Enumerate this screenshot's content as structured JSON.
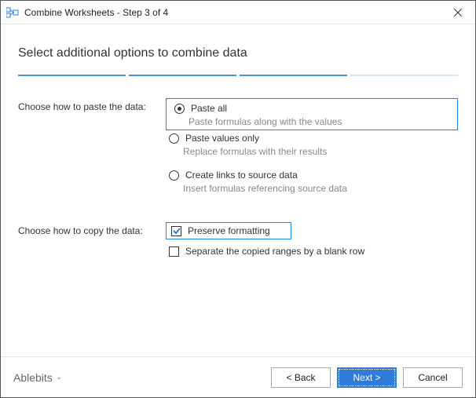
{
  "window": {
    "title": "Combine Worksheets - Step 3 of 4"
  },
  "heading": "Select additional options to combine data",
  "progress": {
    "current": 3,
    "total": 4
  },
  "paste_section": {
    "label": "Choose how to paste the data:",
    "options": [
      {
        "label": "Paste all",
        "desc": "Paste formulas along with the values",
        "selected": true
      },
      {
        "label": "Paste values only",
        "desc": "Replace formulas with their results",
        "selected": false
      },
      {
        "label": "Create links to source data",
        "desc": "Insert formulas referencing source data",
        "selected": false
      }
    ]
  },
  "copy_section": {
    "label": "Choose how to copy the data:",
    "options": [
      {
        "label": "Preserve formatting",
        "checked": true,
        "highlighted": true
      },
      {
        "label": "Separate the copied ranges by a blank row",
        "checked": false,
        "highlighted": false
      }
    ]
  },
  "footer": {
    "brand": "Ablebits",
    "back": "< Back",
    "next": "Next >",
    "cancel": "Cancel"
  }
}
